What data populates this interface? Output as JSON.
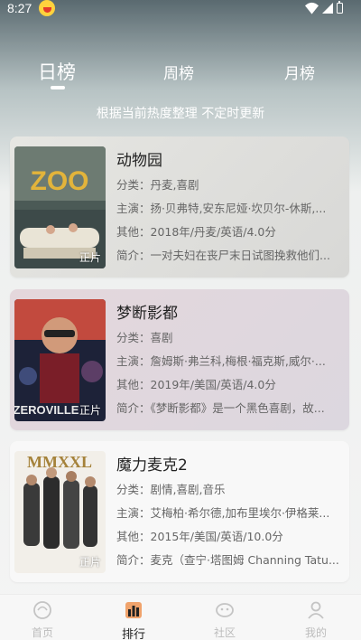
{
  "status": {
    "time": "8:27"
  },
  "tabs": [
    {
      "label": "日榜",
      "active": true
    },
    {
      "label": "周榜",
      "active": false
    },
    {
      "label": "月榜",
      "active": false
    }
  ],
  "subtitle": "根据当前热度整理 不定时更新",
  "movies": [
    {
      "title": "动物园",
      "category": "分类：丹麦,喜剧",
      "cast": "主演：扬·贝弗特,安东尼娅·坎贝尔-休斯,...",
      "other": "其他：2018年/丹麦/英语/4.0分",
      "summary": "简介：一对夫妇在丧尸末日试图挽救他们...",
      "badge": "正片",
      "poster_text": "ZOO"
    },
    {
      "title": "梦断影都",
      "category": "分类：喜剧",
      "cast": "主演：詹姆斯·弗兰科,梅根·福克斯,威尔·...",
      "other": "其他：2019年/美国/英语/4.0分",
      "summary": "简介：《梦断影都》是一个黑色喜剧，故...",
      "badge": "正片",
      "poster_text": "ZEROVILLE"
    },
    {
      "title": "魔力麦克2",
      "category": "分类：剧情,喜剧,音乐",
      "cast": "主演：艾梅柏·希尔德,加布里埃尔·伊格莱...",
      "other": "其他：2015年/美国/英语/10.0分",
      "summary": "简介：麦克（查宁·塔图姆 Channing Tatu...",
      "badge": "正片",
      "poster_text": "MMXXL"
    }
  ],
  "bottom_nav": [
    {
      "label": "首页",
      "icon": "home-icon",
      "active": false
    },
    {
      "label": "排行",
      "icon": "ranking-icon",
      "active": true
    },
    {
      "label": "社区",
      "icon": "community-icon",
      "active": false
    },
    {
      "label": "我的",
      "icon": "profile-icon",
      "active": false
    }
  ]
}
